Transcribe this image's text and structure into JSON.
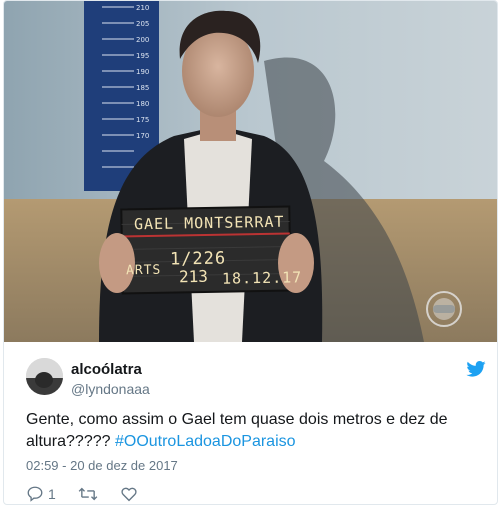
{
  "photo": {
    "board_name": "GAEL MONTSERRAT",
    "board_prefix": "ARTS",
    "board_code": "1/226",
    "board_number": "213",
    "board_date": "18.12.17",
    "height_ticks": [
      "210",
      "205",
      "200",
      "195",
      "190",
      "185",
      "180",
      "175",
      "170"
    ],
    "channel_logo": "globo-logo-icon"
  },
  "tweet": {
    "display_name": "alcoólatra",
    "handle": "@lyndonaaa",
    "text_main": "Gente, como assim o Gael tem quase dois metros e dez de altura????? ",
    "hashtag": "#OOutroLadoaDoParaiso",
    "timestamp": "02:59 - 20 de dez de 2017",
    "reply_count": "1",
    "bird_icon": "twitter-bird-icon",
    "colors": {
      "link": "#1b95e0",
      "bird": "#1da1f2",
      "muted": "#657786"
    }
  }
}
